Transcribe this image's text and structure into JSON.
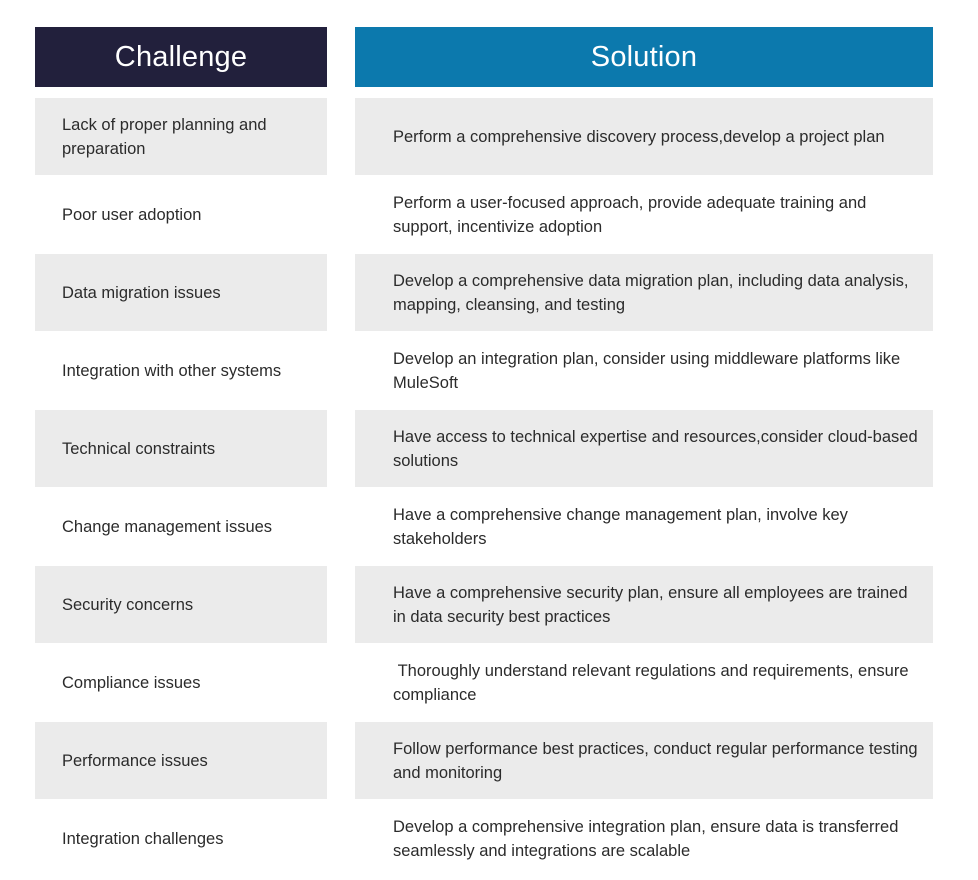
{
  "colors": {
    "challenge_header_bg": "#22203c",
    "solution_header_bg": "#0c79ad",
    "row_shaded_bg": "#ebebeb",
    "row_plain_bg": "#ffffff",
    "header_text": "#ffffff",
    "body_text": "#2b2b2b"
  },
  "table": {
    "headers": {
      "challenge": "Challenge",
      "solution": "Solution"
    },
    "rows": [
      {
        "challenge": "Lack of proper planning and preparation",
        "solution": "Perform a comprehensive discovery process,develop a project plan",
        "shaded": true
      },
      {
        "challenge": "Poor user adoption",
        "solution": "Perform a user-focused approach, provide adequate training and support, incentivize adoption",
        "shaded": false
      },
      {
        "challenge": "Data migration issues",
        "solution": "Develop a comprehensive data migration plan, including data analysis, mapping, cleansing, and testing",
        "shaded": true
      },
      {
        "challenge": "Integration with other systems",
        "solution": "Develop an integration plan, consider using middleware platforms like MuleSoft",
        "shaded": false
      },
      {
        "challenge": "Technical constraints",
        "solution": "Have access to technical expertise and resources,consider cloud-based solutions",
        "shaded": true
      },
      {
        "challenge": "Change management issues",
        "solution": "Have a comprehensive change management plan, involve key stakeholders",
        "shaded": false
      },
      {
        "challenge": "Security concerns",
        "solution": "Have a comprehensive security plan, ensure all employees are trained in data security best practices",
        "shaded": true
      },
      {
        "challenge": "Compliance issues",
        "solution": " Thoroughly understand relevant regulations and requirements, ensure compliance",
        "shaded": false
      },
      {
        "challenge": "Performance issues",
        "solution": "Follow performance best practices, conduct regular performance testing and monitoring",
        "shaded": true
      },
      {
        "challenge": "Integration challenges",
        "solution": "Develop a comprehensive integration plan, ensure data is transferred seamlessly and integrations are scalable",
        "shaded": false
      }
    ]
  }
}
